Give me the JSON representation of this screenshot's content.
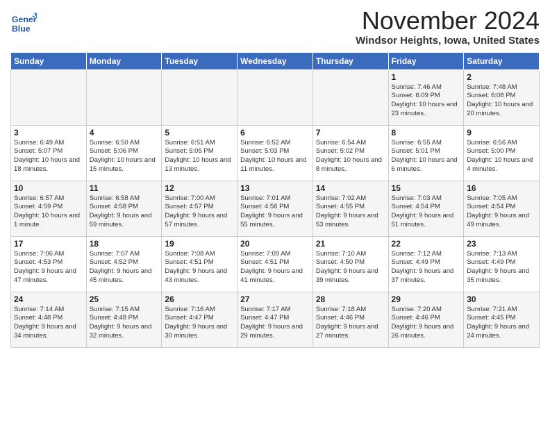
{
  "header": {
    "logo_line1": "General",
    "logo_line2": "Blue",
    "month": "November 2024",
    "location": "Windsor Heights, Iowa, United States"
  },
  "days_of_week": [
    "Sunday",
    "Monday",
    "Tuesday",
    "Wednesday",
    "Thursday",
    "Friday",
    "Saturday"
  ],
  "weeks": [
    [
      {
        "day": "",
        "content": ""
      },
      {
        "day": "",
        "content": ""
      },
      {
        "day": "",
        "content": ""
      },
      {
        "day": "",
        "content": ""
      },
      {
        "day": "",
        "content": ""
      },
      {
        "day": "1",
        "content": "Sunrise: 7:46 AM\nSunset: 6:09 PM\nDaylight: 10 hours and 23 minutes."
      },
      {
        "day": "2",
        "content": "Sunrise: 7:48 AM\nSunset: 6:08 PM\nDaylight: 10 hours and 20 minutes."
      }
    ],
    [
      {
        "day": "3",
        "content": "Sunrise: 6:49 AM\nSunset: 5:07 PM\nDaylight: 10 hours and 18 minutes."
      },
      {
        "day": "4",
        "content": "Sunrise: 6:50 AM\nSunset: 5:06 PM\nDaylight: 10 hours and 15 minutes."
      },
      {
        "day": "5",
        "content": "Sunrise: 6:51 AM\nSunset: 5:05 PM\nDaylight: 10 hours and 13 minutes."
      },
      {
        "day": "6",
        "content": "Sunrise: 6:52 AM\nSunset: 5:03 PM\nDaylight: 10 hours and 11 minutes."
      },
      {
        "day": "7",
        "content": "Sunrise: 6:54 AM\nSunset: 5:02 PM\nDaylight: 10 hours and 8 minutes."
      },
      {
        "day": "8",
        "content": "Sunrise: 6:55 AM\nSunset: 5:01 PM\nDaylight: 10 hours and 6 minutes."
      },
      {
        "day": "9",
        "content": "Sunrise: 6:56 AM\nSunset: 5:00 PM\nDaylight: 10 hours and 4 minutes."
      }
    ],
    [
      {
        "day": "10",
        "content": "Sunrise: 6:57 AM\nSunset: 4:59 PM\nDaylight: 10 hours and 1 minute."
      },
      {
        "day": "11",
        "content": "Sunrise: 6:58 AM\nSunset: 4:58 PM\nDaylight: 9 hours and 59 minutes."
      },
      {
        "day": "12",
        "content": "Sunrise: 7:00 AM\nSunset: 4:57 PM\nDaylight: 9 hours and 57 minutes."
      },
      {
        "day": "13",
        "content": "Sunrise: 7:01 AM\nSunset: 4:56 PM\nDaylight: 9 hours and 55 minutes."
      },
      {
        "day": "14",
        "content": "Sunrise: 7:02 AM\nSunset: 4:55 PM\nDaylight: 9 hours and 53 minutes."
      },
      {
        "day": "15",
        "content": "Sunrise: 7:03 AM\nSunset: 4:54 PM\nDaylight: 9 hours and 51 minutes."
      },
      {
        "day": "16",
        "content": "Sunrise: 7:05 AM\nSunset: 4:54 PM\nDaylight: 9 hours and 49 minutes."
      }
    ],
    [
      {
        "day": "17",
        "content": "Sunrise: 7:06 AM\nSunset: 4:53 PM\nDaylight: 9 hours and 47 minutes."
      },
      {
        "day": "18",
        "content": "Sunrise: 7:07 AM\nSunset: 4:52 PM\nDaylight: 9 hours and 45 minutes."
      },
      {
        "day": "19",
        "content": "Sunrise: 7:08 AM\nSunset: 4:51 PM\nDaylight: 9 hours and 43 minutes."
      },
      {
        "day": "20",
        "content": "Sunrise: 7:09 AM\nSunset: 4:51 PM\nDaylight: 9 hours and 41 minutes."
      },
      {
        "day": "21",
        "content": "Sunrise: 7:10 AM\nSunset: 4:50 PM\nDaylight: 9 hours and 39 minutes."
      },
      {
        "day": "22",
        "content": "Sunrise: 7:12 AM\nSunset: 4:49 PM\nDaylight: 9 hours and 37 minutes."
      },
      {
        "day": "23",
        "content": "Sunrise: 7:13 AM\nSunset: 4:49 PM\nDaylight: 9 hours and 35 minutes."
      }
    ],
    [
      {
        "day": "24",
        "content": "Sunrise: 7:14 AM\nSunset: 4:48 PM\nDaylight: 9 hours and 34 minutes."
      },
      {
        "day": "25",
        "content": "Sunrise: 7:15 AM\nSunset: 4:48 PM\nDaylight: 9 hours and 32 minutes."
      },
      {
        "day": "26",
        "content": "Sunrise: 7:16 AM\nSunset: 4:47 PM\nDaylight: 9 hours and 30 minutes."
      },
      {
        "day": "27",
        "content": "Sunrise: 7:17 AM\nSunset: 4:47 PM\nDaylight: 9 hours and 29 minutes."
      },
      {
        "day": "28",
        "content": "Sunrise: 7:18 AM\nSunset: 4:46 PM\nDaylight: 9 hours and 27 minutes."
      },
      {
        "day": "29",
        "content": "Sunrise: 7:20 AM\nSunset: 4:46 PM\nDaylight: 9 hours and 26 minutes."
      },
      {
        "day": "30",
        "content": "Sunrise: 7:21 AM\nSunset: 4:45 PM\nDaylight: 9 hours and 24 minutes."
      }
    ]
  ]
}
